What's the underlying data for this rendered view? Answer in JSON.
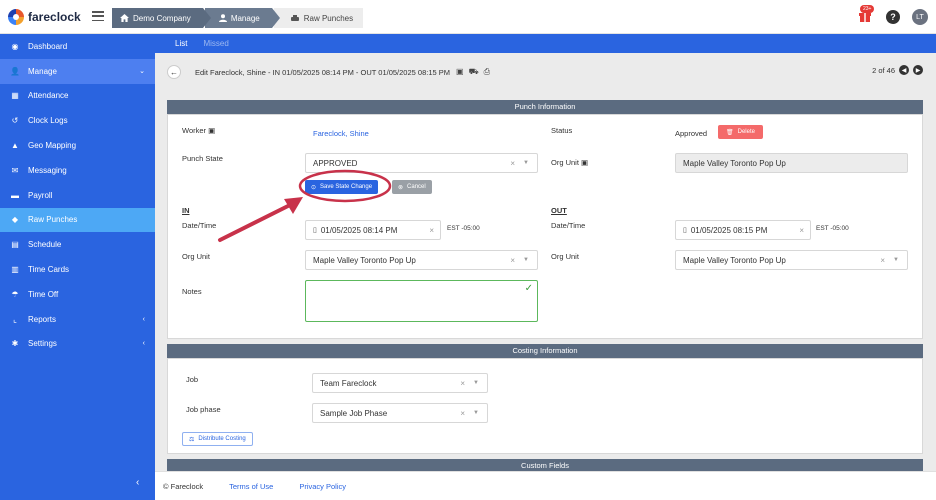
{
  "app": {
    "logo_text": "fareclock"
  },
  "breadcrumbs": [
    {
      "label": "Demo Company",
      "icon": "home-icon"
    },
    {
      "label": "Manage",
      "icon": "user-icon"
    },
    {
      "label": "Raw Punches",
      "icon": "punch-icon"
    }
  ],
  "header": {
    "notification_count": "23+",
    "help_glyph": "?",
    "avatar_initials": "LT"
  },
  "sidebar": {
    "items": [
      {
        "label": "Dashboard",
        "icon": "dashboard-icon"
      },
      {
        "label": "Manage",
        "icon": "manage-icon"
      },
      {
        "label": "Attendance",
        "icon": "attendance-icon"
      },
      {
        "label": "Clock Logs",
        "icon": "clock-logs-icon"
      },
      {
        "label": "Geo Mapping",
        "icon": "geo-mapping-icon"
      },
      {
        "label": "Messaging",
        "icon": "messaging-icon"
      },
      {
        "label": "Payroll",
        "icon": "payroll-icon"
      },
      {
        "label": "Raw Punches",
        "icon": "raw-punches-icon"
      },
      {
        "label": "Schedule",
        "icon": "schedule-icon"
      },
      {
        "label": "Time Cards",
        "icon": "time-cards-icon"
      },
      {
        "label": "Time Off",
        "icon": "time-off-icon"
      },
      {
        "label": "Reports",
        "icon": "reports-icon"
      },
      {
        "label": "Settings",
        "icon": "settings-icon"
      }
    ],
    "active_item": "Raw Punches",
    "expanded_item": "Manage"
  },
  "subtabs": [
    {
      "label": "List"
    },
    {
      "label": "Missed"
    }
  ],
  "edit": {
    "title": "Edit Fareclock, Shine - IN 01/05/2025 08:14 PM - OUT 01/05/2025 08:15 PM",
    "pager": "2 of 46"
  },
  "punch": {
    "section_title": "Punch Information",
    "worker_label": "Worker",
    "worker_value": "Fareclock, Shine",
    "status_label": "Status",
    "status_value": "Approved",
    "delete_label": "Delete",
    "punch_state_label": "Punch State",
    "punch_state_value": "APPROVED",
    "org_unit_label": "Org Unit",
    "org_unit_value": "Maple Valley Toronto Pop Up",
    "save_state_label": "Save State Change",
    "cancel_label": "Cancel",
    "in": {
      "heading": "IN",
      "datetime_label": "Date/Time",
      "datetime_value": "01/05/2025 08:14 PM",
      "tz": "EST -05:00",
      "org_unit_label": "Org Unit",
      "org_unit_value": "Maple Valley Toronto Pop Up"
    },
    "out": {
      "heading": "OUT",
      "datetime_label": "Date/Time",
      "datetime_value": "01/05/2025 08:15 PM",
      "tz": "EST -05:00",
      "org_unit_label": "Org Unit",
      "org_unit_value": "Maple Valley Toronto Pop Up"
    },
    "notes_label": "Notes",
    "notes_value": ""
  },
  "costing": {
    "section_title": "Costing Information",
    "job_label": "Job",
    "job_value": "Team Fareclock",
    "job_phase_label": "Job phase",
    "job_phase_value": "Sample Job Phase",
    "distribute_label": "Distribute Costing"
  },
  "custom": {
    "section_title": "Custom Fields"
  },
  "footer": {
    "copyright": "© Fareclock",
    "terms": "Terms of Use",
    "privacy": "Privacy Policy"
  },
  "colors": {
    "accent": "#2a64e0",
    "section_header": "#5b6b80",
    "annotation": "#c8324a",
    "delete": "#f46a6a"
  }
}
